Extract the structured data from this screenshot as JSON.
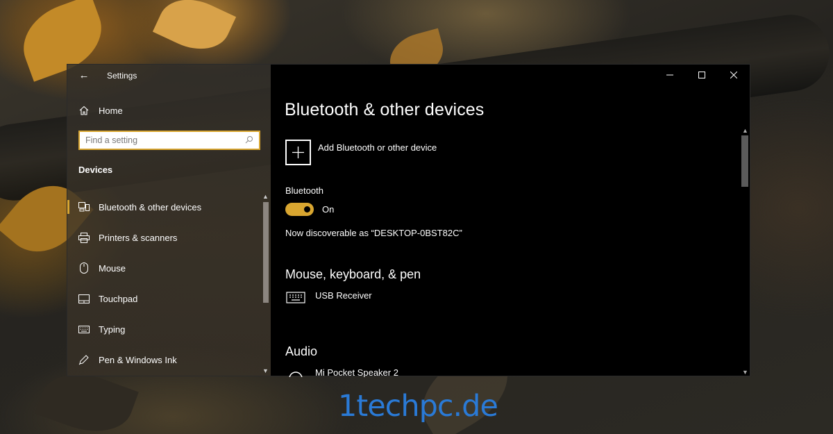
{
  "window": {
    "app_title": "Settings",
    "back_label": "←",
    "controls": {
      "minimize": "—",
      "maximize": "☐",
      "close": "✕"
    }
  },
  "sidebar": {
    "home_label": "Home",
    "search_placeholder": "Find a setting",
    "section_title": "Devices",
    "items": [
      {
        "label": "Bluetooth & other devices",
        "icon": "bluetooth-devices-icon",
        "active": true
      },
      {
        "label": "Printers & scanners",
        "icon": "printer-icon",
        "active": false
      },
      {
        "label": "Mouse",
        "icon": "mouse-icon",
        "active": false
      },
      {
        "label": "Touchpad",
        "icon": "touchpad-icon",
        "active": false
      },
      {
        "label": "Typing",
        "icon": "keyboard-icon",
        "active": false
      },
      {
        "label": "Pen & Windows Ink",
        "icon": "pen-icon",
        "active": false
      }
    ]
  },
  "main": {
    "title": "Bluetooth & other devices",
    "add_device_label": "Add Bluetooth or other device",
    "bluetooth_label": "Bluetooth",
    "toggle_state": "On",
    "discoverable_text": "Now discoverable as “DESKTOP-0BST82C”",
    "mouse_section": "Mouse, keyboard, & pen",
    "mouse_devices": [
      {
        "name": "USB Receiver",
        "icon": "keyboard-icon"
      }
    ],
    "audio_section": "Audio",
    "audio_devices": [
      {
        "name": "Mi Pocket Speaker 2",
        "icon": "headset-icon"
      }
    ]
  },
  "watermark": "1techpc.de",
  "colors": {
    "accent": "#d9a630",
    "watermark": "#2a7ad6",
    "main_bg": "#000000"
  }
}
